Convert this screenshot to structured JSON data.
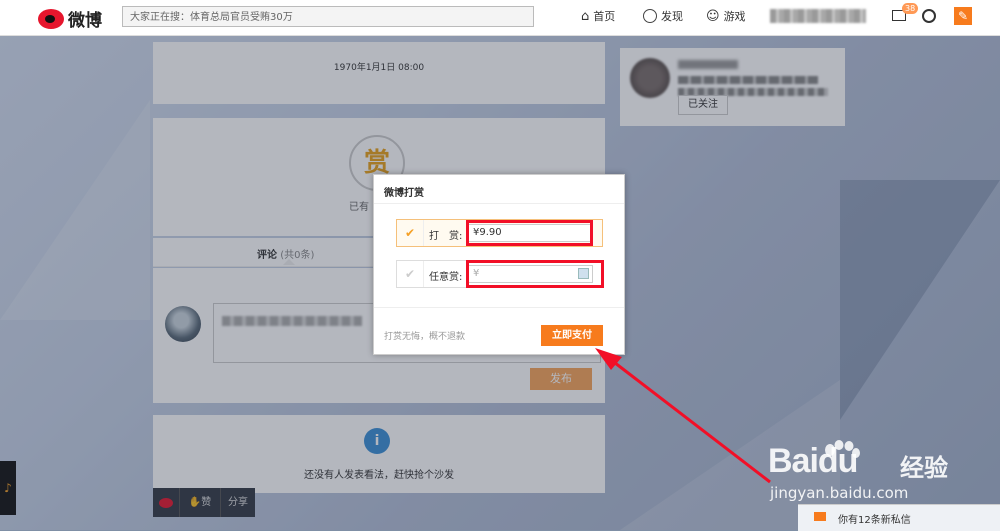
{
  "topbar": {
    "logo_text": "微博",
    "search_placeholder": "大家正在搜：体育总局官员受贿30万",
    "nav": {
      "home": "首页",
      "discover": "发现",
      "games": "游戏"
    },
    "mail_badge": "38"
  },
  "feed": {
    "date": "1970年1月1日 08:00",
    "reward_char": "赏",
    "already_prefix": "已有",
    "comment_tab": "评论",
    "comment_count": "(共0条)",
    "publish_label": "发布",
    "no_comments": "还没有人发表看法，赶快抢个沙发"
  },
  "profile": {
    "follow_status": "已关注"
  },
  "modal": {
    "title": "微博打赏",
    "option1_label": "打　赏:",
    "option1_value": "¥9.90",
    "option2_label": "任意赏:",
    "option2_placeholder": "¥",
    "note": "打赏无悔，概不退款",
    "pay_label": "立即支付"
  },
  "share_bar": {
    "like_label": "赞",
    "share_label": "分享"
  },
  "watermark": {
    "brand": "Baidu",
    "brand_cn": "经验",
    "url": "jingyan.baidu.com"
  },
  "notification": {
    "text": "你有12条新私信"
  },
  "colors": {
    "accent": "#f77b1d",
    "highlight": "#f20f27",
    "weibo_red": "#e6162d"
  }
}
